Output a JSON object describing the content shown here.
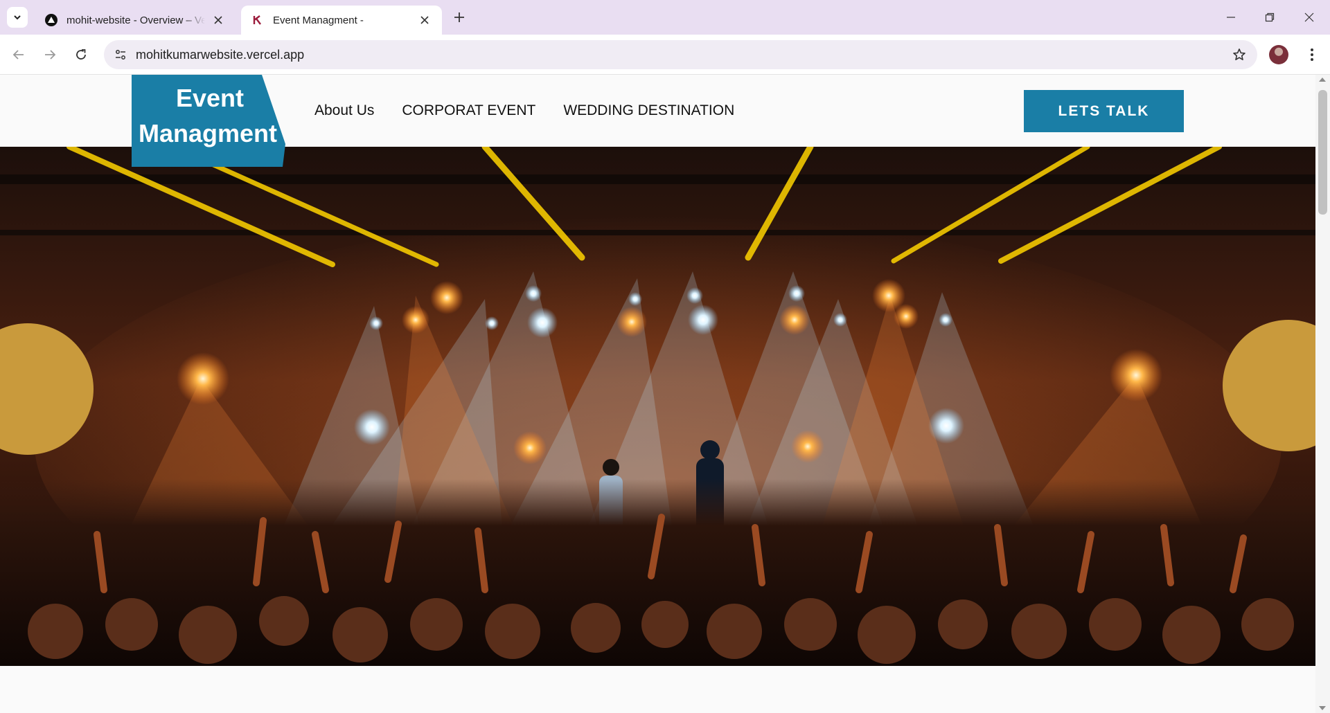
{
  "browser": {
    "tabs": [
      {
        "title": "mohit-website - Overview – Vercel",
        "icon": "vercel-icon",
        "active": false
      },
      {
        "title": "Event Managment -",
        "icon": "site-favicon-icon",
        "active": true
      }
    ],
    "address": "mohitkumarwebsite.vercel.app"
  },
  "site": {
    "logo": {
      "line1": "Event",
      "line2": "Managment"
    },
    "nav": [
      {
        "label": "About Us"
      },
      {
        "label": "CORPORAT EVENT"
      },
      {
        "label": "WEDDING DESTINATION"
      }
    ],
    "cta_label": "LETS TALK",
    "colors": {
      "accent": "#1a7ea6",
      "page_bg": "#fafafa"
    },
    "hero": {
      "image": "concert-stage-lights-crowd"
    }
  }
}
